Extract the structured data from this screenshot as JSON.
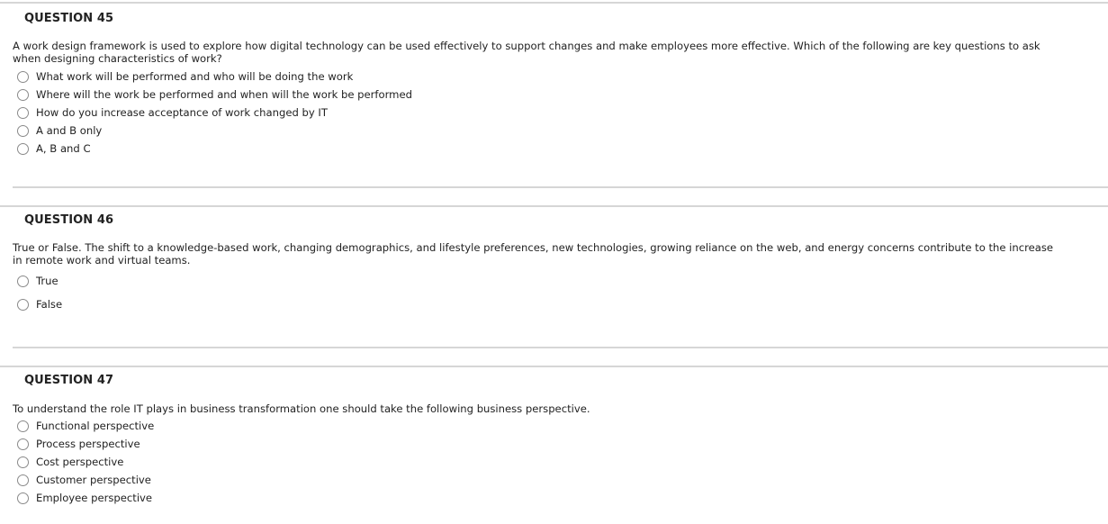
{
  "questions": [
    {
      "header": "QUESTION 45",
      "text": "A work design framework is used to explore how digital technology can be used effectively to support changes and make employees more effective.  Which of the following are key questions to ask when designing characteristics of work?",
      "options": [
        "What work will be performed and who will be doing the work",
        "Where will the work be performed and when will the work be performed",
        "How do you increase acceptance of work changed by IT",
        "A and B only",
        "A, B and C"
      ],
      "icons": {
        "option": "radio-unselected-icon"
      }
    },
    {
      "header": "QUESTION 46",
      "text": "True or False.  The shift to a knowledge-based work, changing demographics, and lifestyle preferences, new technologies, growing reliance on the web, and energy concerns contribute to the increase in remote work and virtual teams.",
      "options": [
        "True",
        "False"
      ],
      "icons": {
        "option": "radio-unselected-icon"
      }
    },
    {
      "header": "QUESTION 47",
      "text": "To understand the role IT plays in business transformation one should take the following business perspective.",
      "options": [
        "Functional perspective",
        "Process perspective",
        "Cost perspective",
        "Customer perspective",
        "Employee perspective"
      ],
      "icons": {
        "option": "radio-unselected-icon"
      }
    }
  ],
  "colors": {
    "border": "#d6d6d6",
    "text": "#222222",
    "radio_border": "#8a8a8a"
  }
}
